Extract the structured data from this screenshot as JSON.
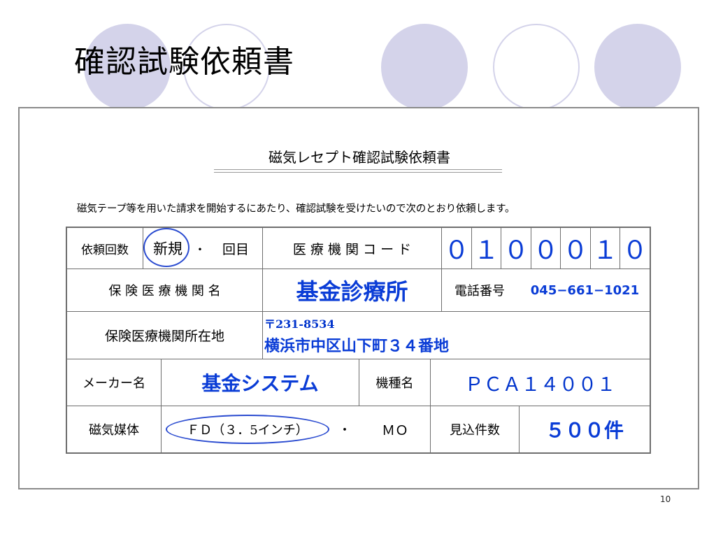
{
  "slide": {
    "title": "確認試験依頼書",
    "page_number": "10"
  },
  "form": {
    "heading": "磁気レセプト確認試験依頼書",
    "intro": "磁気テープ等を用いた請求を開始するにあたり、確認試験を受けたいので次のとおり依頼します。",
    "row1": {
      "label": "依頼回数",
      "option_new": "新規",
      "option_sep": "・",
      "option_times": "回目",
      "code_label": "医 療 機 関 コ ー ド",
      "code_digits": [
        "０",
        "１",
        "０",
        "０",
        "０",
        "１",
        "０"
      ]
    },
    "row2": {
      "label": "保 険 医 療 機 関 名",
      "value": "基金診療所",
      "phone_label": "電話番号",
      "phone_value": "045−661−1021"
    },
    "row3": {
      "label": "保険医療機関所在地",
      "postal": "〒231-8534",
      "address": "横浜市中区山下町３４番地"
    },
    "row4": {
      "label": "メーカー名",
      "value": "基金システム",
      "model_label": "機種名",
      "model_value": "ＰＣＡ１４００１"
    },
    "row5": {
      "label": "磁気媒体",
      "media_fd": "ＦＤ（３．5インチ）",
      "media_sep": "・",
      "media_mo": "ＭＯ",
      "count_label": "見込件数",
      "count_value": "５００件"
    }
  }
}
